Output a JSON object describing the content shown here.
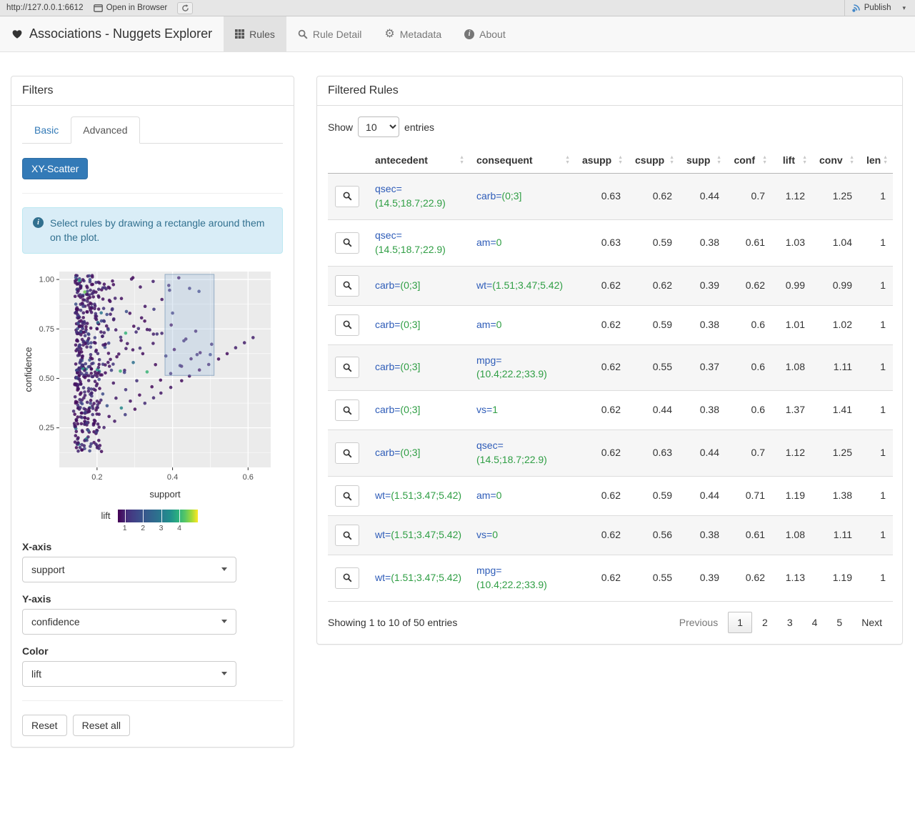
{
  "colors": {
    "accent": "#337ab7",
    "attr_name": "#2e5cb8",
    "attr_value": "#2f9e44",
    "alert_bg": "#d9edf7",
    "alert_text": "#31708f"
  },
  "viewer_bar": {
    "url": "http://127.0.0.1:6612",
    "open_in_browser_label": "Open in Browser",
    "publish_label": "Publish"
  },
  "navbar": {
    "brand": "Associations - Nuggets Explorer",
    "tabs": [
      {
        "label": "Rules",
        "icon": "table-icon",
        "active": true
      },
      {
        "label": "Rule Detail",
        "icon": "search-icon",
        "active": false
      },
      {
        "label": "Metadata",
        "icon": "gear-icon",
        "active": false
      },
      {
        "label": "About",
        "icon": "info-icon",
        "active": false
      }
    ]
  },
  "filters": {
    "title": "Filters",
    "tab_basic": "Basic",
    "tab_advanced": "Advanced",
    "scatter_button_label": "XY-Scatter",
    "alert_text": "Select rules by drawing a rectangle around them on the plot.",
    "x_axis": {
      "label": "X-axis",
      "value": "support"
    },
    "y_axis": {
      "label": "Y-axis",
      "value": "confidence"
    },
    "color": {
      "label": "Color",
      "value": "lift"
    },
    "reset_label": "Reset",
    "reset_all_label": "Reset all"
  },
  "chart_data": {
    "type": "scatter",
    "xlabel": "support",
    "ylabel": "confidence",
    "xlim": [
      0.1,
      0.66
    ],
    "ylim": [
      0.05,
      1.04
    ],
    "x_ticks": [
      0.2,
      0.4,
      0.6
    ],
    "x_tick_labels": [
      "0.2",
      "0.4",
      "0.6"
    ],
    "y_ticks": [
      0.25,
      0.5,
      0.75,
      1.0
    ],
    "y_tick_labels": [
      "0.25",
      "0.50",
      "0.75",
      "1.00"
    ],
    "grid": true,
    "color_label": "lift",
    "color_scale": {
      "ticks": [
        1,
        2,
        3,
        4
      ],
      "domain": [
        0.6,
        5.0
      ],
      "colormap": "viridis"
    },
    "selection_rect": {
      "x": [
        0.38,
        0.51
      ],
      "y": [
        0.515,
        1.026
      ]
    },
    "points_summary": "dense cloud of rules at support 0.14-0.35 spanning confidence 0.1-1.0, with diagonal chains of points extending to support ~0.64; point color encodes lift (mostly 1-1.5, few up to 4)"
  },
  "rules_table": {
    "title": "Filtered Rules",
    "show_label": "Show",
    "entries_label": "entries",
    "page_length": "10",
    "columns": [
      "",
      "antecedent",
      "consequent",
      "asupp",
      "csupp",
      "supp",
      "conf",
      "lift",
      "conv",
      "len"
    ],
    "rows": [
      {
        "antecedent": {
          "name": "qsec=",
          "value": "(14.5;18.7;22.9)"
        },
        "consequent": {
          "name": "carb=",
          "value": "(0;3]"
        },
        "asupp": "0.63",
        "csupp": "0.62",
        "supp": "0.44",
        "conf": "0.7",
        "lift": "1.12",
        "conv": "1.25",
        "len": "1"
      },
      {
        "antecedent": {
          "name": "qsec=",
          "value": "(14.5;18.7;22.9)"
        },
        "consequent": {
          "name": "am=",
          "value": "0"
        },
        "asupp": "0.63",
        "csupp": "0.59",
        "supp": "0.38",
        "conf": "0.61",
        "lift": "1.03",
        "conv": "1.04",
        "len": "1"
      },
      {
        "antecedent": {
          "name": "carb=",
          "value": "(0;3]"
        },
        "consequent": {
          "name": "wt=",
          "value": "(1.51;3.47;5.42)"
        },
        "asupp": "0.62",
        "csupp": "0.62",
        "supp": "0.39",
        "conf": "0.62",
        "lift": "0.99",
        "conv": "0.99",
        "len": "1"
      },
      {
        "antecedent": {
          "name": "carb=",
          "value": "(0;3]"
        },
        "consequent": {
          "name": "am=",
          "value": "0"
        },
        "asupp": "0.62",
        "csupp": "0.59",
        "supp": "0.38",
        "conf": "0.6",
        "lift": "1.01",
        "conv": "1.02",
        "len": "1"
      },
      {
        "antecedent": {
          "name": "carb=",
          "value": "(0;3]"
        },
        "consequent": {
          "name": "mpg=",
          "value": "(10.4;22.2;33.9)"
        },
        "asupp": "0.62",
        "csupp": "0.55",
        "supp": "0.37",
        "conf": "0.6",
        "lift": "1.08",
        "conv": "1.11",
        "len": "1"
      },
      {
        "antecedent": {
          "name": "carb=",
          "value": "(0;3]"
        },
        "consequent": {
          "name": "vs=",
          "value": "1"
        },
        "asupp": "0.62",
        "csupp": "0.44",
        "supp": "0.38",
        "conf": "0.6",
        "lift": "1.37",
        "conv": "1.41",
        "len": "1"
      },
      {
        "antecedent": {
          "name": "carb=",
          "value": "(0;3]"
        },
        "consequent": {
          "name": "qsec=",
          "value": "(14.5;18.7;22.9)"
        },
        "asupp": "0.62",
        "csupp": "0.63",
        "supp": "0.44",
        "conf": "0.7",
        "lift": "1.12",
        "conv": "1.25",
        "len": "1"
      },
      {
        "antecedent": {
          "name": "wt=",
          "value": "(1.51;3.47;5.42)"
        },
        "consequent": {
          "name": "am=",
          "value": "0"
        },
        "asupp": "0.62",
        "csupp": "0.59",
        "supp": "0.44",
        "conf": "0.71",
        "lift": "1.19",
        "conv": "1.38",
        "len": "1"
      },
      {
        "antecedent": {
          "name": "wt=",
          "value": "(1.51;3.47;5.42)"
        },
        "consequent": {
          "name": "vs=",
          "value": "0"
        },
        "asupp": "0.62",
        "csupp": "0.56",
        "supp": "0.38",
        "conf": "0.61",
        "lift": "1.08",
        "conv": "1.11",
        "len": "1"
      },
      {
        "antecedent": {
          "name": "wt=",
          "value": "(1.51;3.47;5.42)"
        },
        "consequent": {
          "name": "mpg=",
          "value": "(10.4;22.2;33.9)"
        },
        "asupp": "0.62",
        "csupp": "0.55",
        "supp": "0.39",
        "conf": "0.62",
        "lift": "1.13",
        "conv": "1.19",
        "len": "1"
      }
    ],
    "info": "Showing 1 to 10 of 50 entries",
    "pagination": {
      "previous_label": "Previous",
      "pages": [
        "1",
        "2",
        "3",
        "4",
        "5"
      ],
      "active_page": "1",
      "next_label": "Next"
    }
  }
}
